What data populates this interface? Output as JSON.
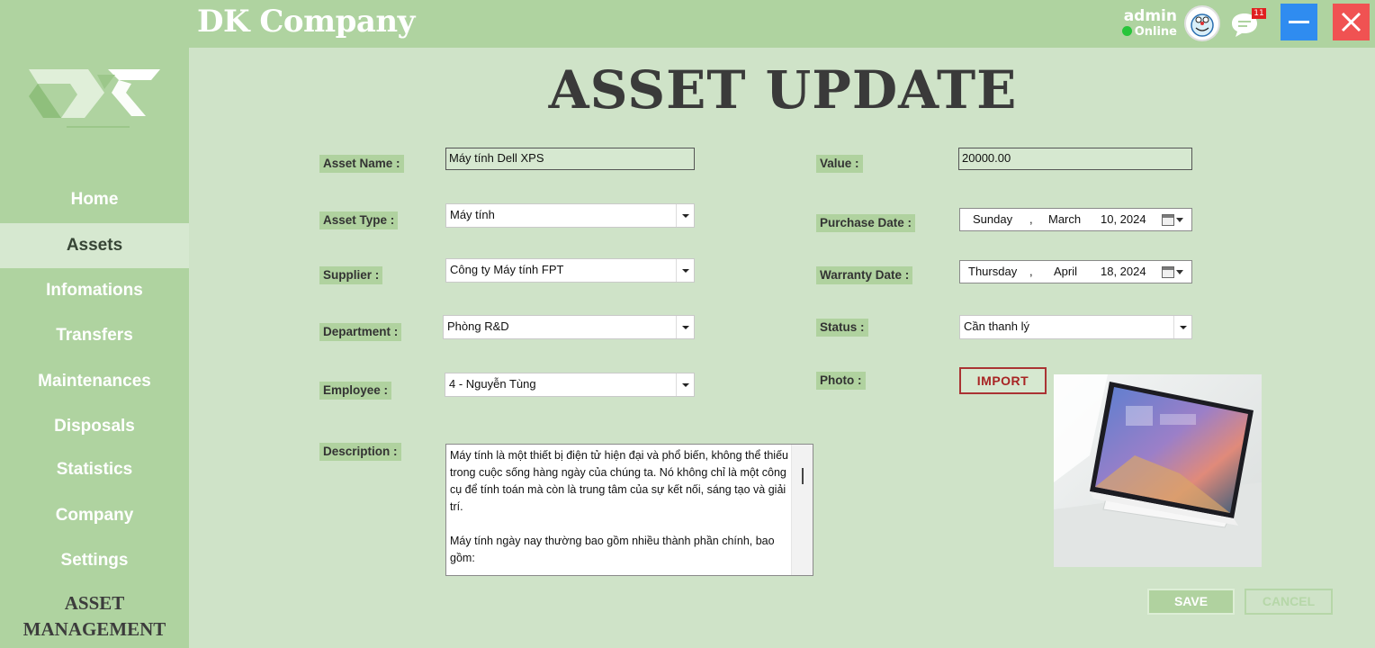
{
  "header": {
    "app_title": "DK Company",
    "user_name": "admin",
    "user_status": "Online",
    "notification_count": "11",
    "icons": [
      "avatar",
      "chat-icon",
      "minimize-icon",
      "close-icon"
    ]
  },
  "sidebar": {
    "items": [
      {
        "label": "Home",
        "active": false
      },
      {
        "label": "Assets",
        "active": true
      },
      {
        "label": "Infomations",
        "active": false
      },
      {
        "label": "Transfers",
        "active": false
      },
      {
        "label": "Maintenances",
        "active": false
      },
      {
        "label": "Disposals",
        "active": false
      },
      {
        "label": "Statistics",
        "active": false
      },
      {
        "label": "Company",
        "active": false
      },
      {
        "label": "Settings",
        "active": false
      }
    ],
    "footer_line1": "ASSET",
    "footer_line2": "MANAGEMENT"
  },
  "page": {
    "title": "ASSET UPDATE"
  },
  "form": {
    "asset_name_label": "Asset Name :",
    "asset_name_value": "Máy tính Dell XPS",
    "asset_type_label": "Asset Type :",
    "asset_type_value": "Máy tính",
    "supplier_label": "Supplier :",
    "supplier_value": "Công ty Máy tính FPT",
    "department_label": "Department :",
    "department_value": "Phòng R&D",
    "employee_label": "Employee :",
    "employee_value": "4 - Nguyễn Tùng",
    "description_label": "Description :",
    "description_value": "Máy tính là một thiết bị điện tử hiện đại và phổ biến, không thể thiếu trong cuộc sống hàng ngày của chúng ta. Nó không chỉ là một công cụ để tính toán mà còn là trung tâm của sự kết nối, sáng tạo và giải trí.\n\nMáy tính ngày nay thường bao gồm nhiều thành phần chính, bao gồm:",
    "value_label": "Value :",
    "value_value": "20000.00",
    "purchase_date_label": "Purchase Date :",
    "purchase_date": {
      "weekday": "Sunday",
      "sep": ",",
      "month": "March",
      "day_year": "10, 2024"
    },
    "warranty_date_label": "Warranty Date :",
    "warranty_date": {
      "weekday": "Thursday",
      "sep": ",",
      "month": "April",
      "day_year": "18, 2024"
    },
    "status_label": "Status :",
    "status_value": "Cần thanh lý",
    "photo_label": "Photo :",
    "import_button": "IMPORT"
  },
  "actions": {
    "save": "SAVE",
    "cancel": "CANCEL"
  },
  "colors": {
    "sidebar_bg": "#afd3a0",
    "main_bg": "#cfe3c8",
    "label_bg": "#b0d29f",
    "minimize_btn": "#2f8cf0",
    "close_btn": "#f05252",
    "import_accent": "#a82424"
  }
}
